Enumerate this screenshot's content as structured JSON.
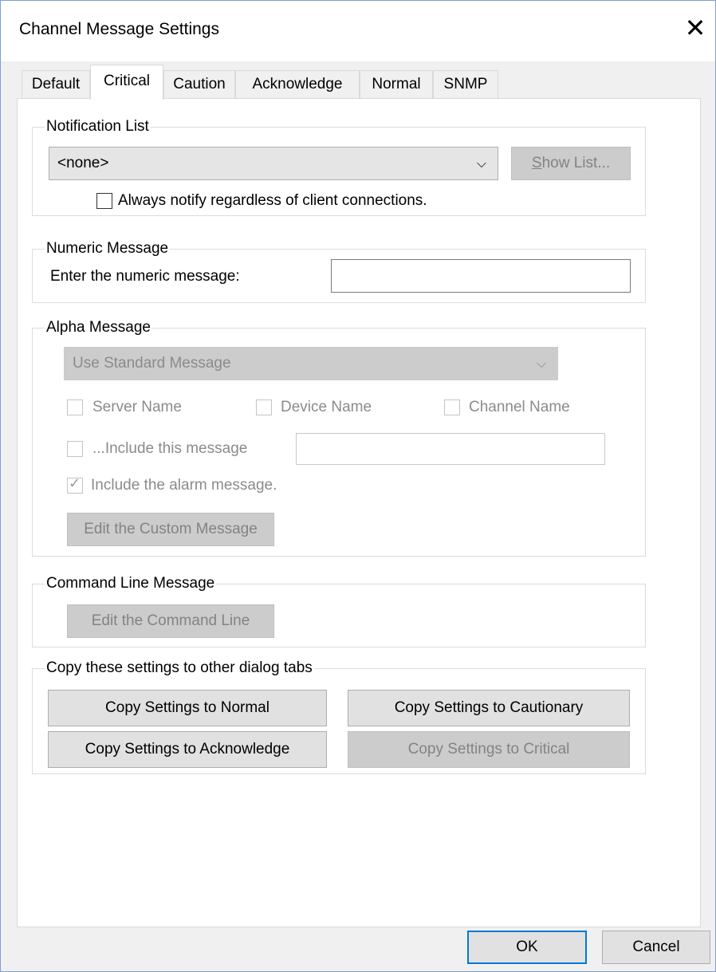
{
  "window": {
    "title": "Channel Message Settings",
    "close_glyph": "✕"
  },
  "tabs": [
    {
      "label": "Default"
    },
    {
      "label": "Critical",
      "active": true
    },
    {
      "label": "Caution"
    },
    {
      "label": "Acknowledge"
    },
    {
      "label": "Normal"
    },
    {
      "label": "SNMP"
    }
  ],
  "notification_list": {
    "legend": "Notification List",
    "select_value": "<none>",
    "show_list_first_letter": "S",
    "show_list_rest": "how List...",
    "always_notify_label": "Always notify regardless of client connections.",
    "always_notify_checked": false
  },
  "numeric_message": {
    "legend": "Numeric Message",
    "prompt": "Enter the numeric message:",
    "value": ""
  },
  "alpha_message": {
    "legend": "Alpha Message",
    "select_value": "Use Standard Message",
    "server_name_label": "Server Name",
    "device_name_label": "Device Name",
    "channel_name_label": "Channel Name",
    "include_this_label": "...Include this message",
    "include_this_value": "",
    "include_alarm_label": "Include the alarm message.",
    "include_alarm_checked": true,
    "edit_custom_label": "Edit the Custom Message"
  },
  "command_line": {
    "legend": "Command Line Message",
    "edit_label": "Edit the Command Line"
  },
  "copy_settings": {
    "legend": "Copy these settings to other dialog tabs",
    "to_normal": "Copy Settings to Normal",
    "to_cautionary": "Copy Settings to Cautionary",
    "to_acknowledge": "Copy Settings to Acknowledge",
    "to_critical": "Copy Settings to Critical"
  },
  "footer": {
    "ok_label": "OK",
    "cancel_label": "Cancel"
  },
  "icons": {
    "close": "close-icon",
    "dropdown": "chevron-down-icon",
    "check": "checkmark-icon"
  },
  "colors": {
    "accent": "#0078d7",
    "disabled_text": "#8b8b8b",
    "dialog_bg": "#f0f0f0"
  }
}
